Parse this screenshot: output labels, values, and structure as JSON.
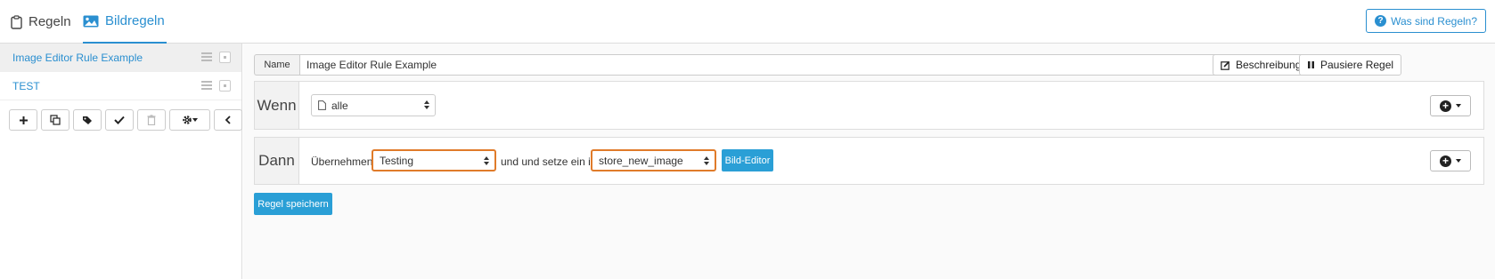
{
  "tabs": [
    {
      "label": "Regeln",
      "icon": "clipboard-icon"
    },
    {
      "label": "Bildregeln",
      "icon": "image-icon"
    }
  ],
  "help_button": {
    "label": "Was sind Regeln?"
  },
  "sidebar": {
    "rules": [
      {
        "label": "Image Editor Rule Example",
        "active": true
      },
      {
        "label": "TEST",
        "active": false
      }
    ],
    "toolbar": [
      "plus-icon",
      "copy-icon",
      "tags-icon",
      "check-icon",
      "trash-icon",
      "gear-icon",
      "chevron-left-icon"
    ]
  },
  "rule": {
    "name_label": "Name",
    "name_value": "Image Editor Rule Example",
    "description_button": "Beschreibung",
    "pause_button": "Pausiere Regel"
  },
  "when": {
    "title": "Wenn",
    "select_value": "alle"
  },
  "then": {
    "title": "Dann",
    "apply_label": "Übernehmen",
    "source_select": "Testing",
    "middle_label": "und und setze ein in",
    "target_select": "store_new_image",
    "editor_button": "Bild-Editor"
  },
  "save_button": "Regel speichern",
  "colors": {
    "accent": "#2a8fd0",
    "highlight": "#e07b2a",
    "primary": "#2a9fd6"
  }
}
